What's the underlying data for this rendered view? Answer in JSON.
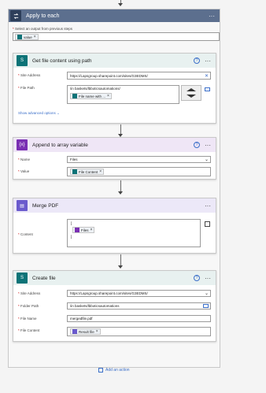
{
  "container": {
    "title": "Apply to each",
    "select_label": "Select an output from previous steps",
    "select_token": "value"
  },
  "get_file": {
    "title": "Get file content using path",
    "site_label": "Site Address",
    "site_value": "https://Lapsgroup.sharepoint.com/sites/G3EDMS/",
    "path_label": "File Path",
    "path_value": "/in baskets/lbboticsautomations/",
    "path_token": "File name with ...",
    "advanced": "Show advanced options"
  },
  "append": {
    "title": "Append to array variable",
    "name_label": "Name",
    "name_value": "Files",
    "value_label": "Value",
    "value_token": "File Content"
  },
  "merge": {
    "title": "Merge PDF",
    "content_label": "Content",
    "open_bracket": "[",
    "close_bracket": "]",
    "content_token": "Files"
  },
  "create": {
    "title": "Create file",
    "site_label": "Site Address",
    "site_value": "https://Lapsgroup.sharepoint.com/sites/G3EDMS/",
    "folder_label": "Folder Path",
    "folder_value": "/in baskets/lbboticsautomations",
    "name_label": "File Name",
    "name_value": "mergedfile.pdf",
    "content_label": "File Content",
    "content_token": "Result file"
  },
  "add_action": "Add an action",
  "colors": {
    "sharepoint": "#0d7377",
    "variable": "#7a2fb3",
    "merge": "#6a5acd",
    "accent": "#3b6fc9"
  }
}
